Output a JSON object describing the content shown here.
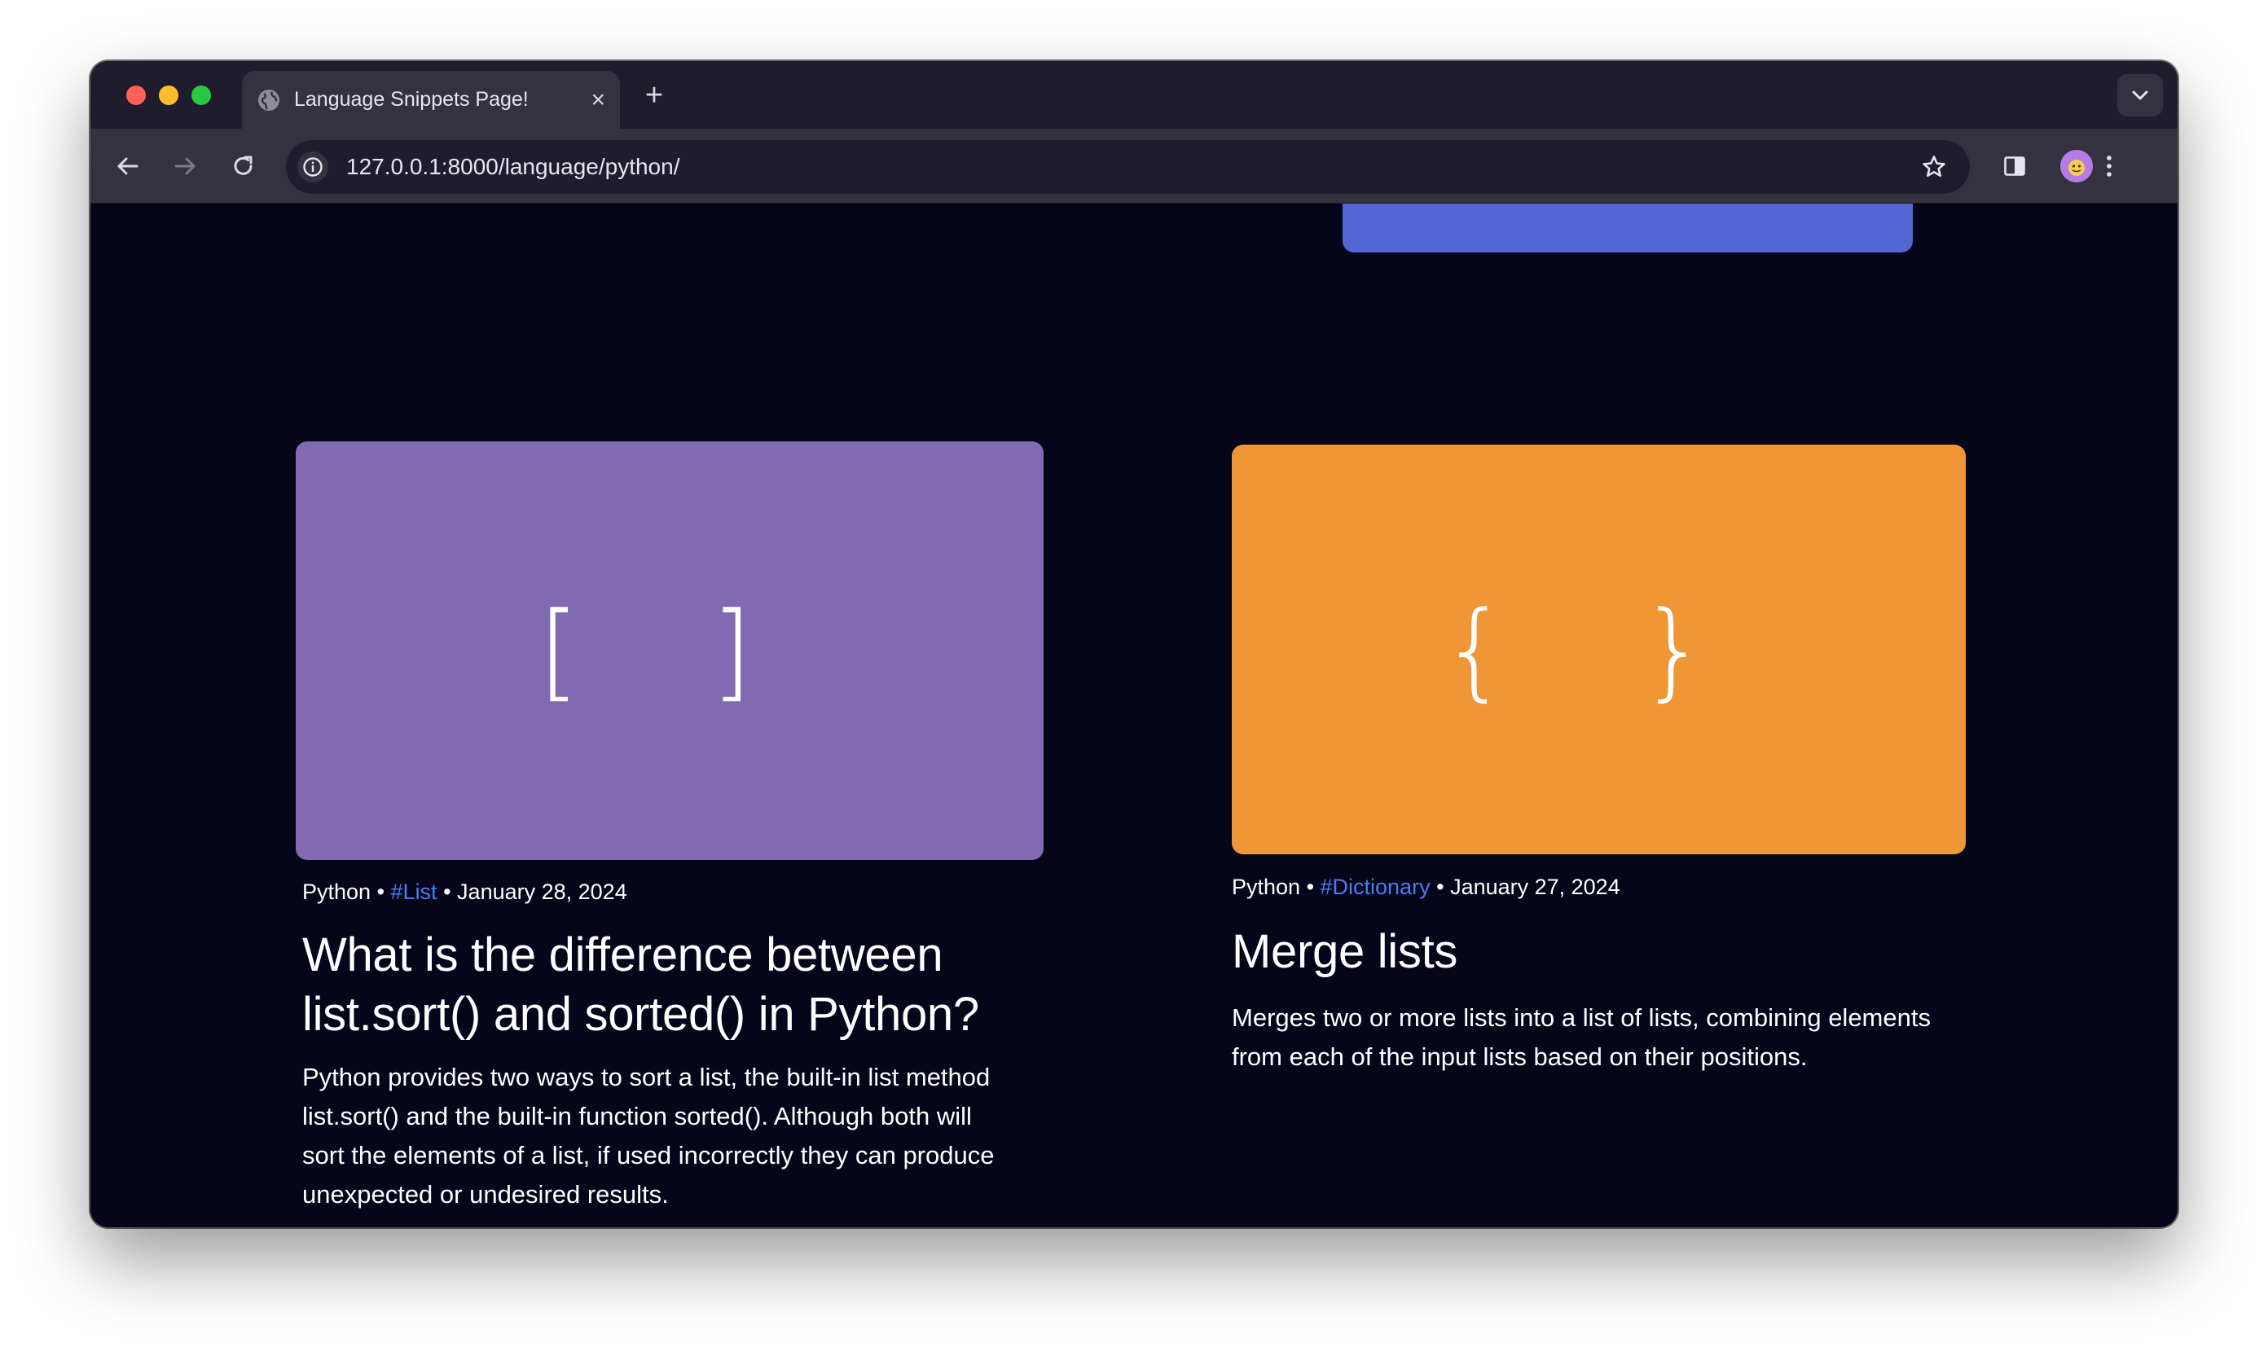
{
  "browser": {
    "tab": {
      "title": "Language Snippets Page!",
      "close_glyph": "×"
    },
    "new_tab_glyph": "+",
    "address_bar": {
      "url": "127.0.0.1:8000/language/python/"
    }
  },
  "cards": [
    {
      "thumbnail_glyph": "[ ]",
      "thumbnail_color": "#806bb3",
      "language": "Python",
      "separator": " • ",
      "tag": "#List",
      "date": "January 28, 2024",
      "title_line1": "What is the difference between",
      "title_line2": "list.sort() and sorted() in Python?",
      "desc_lines": [
        "Python provides two ways to sort a list, the built-in list method",
        "list.sort() and the built-in function sorted(). Although both will",
        "sort the elements of a list, if used incorrectly they can produce",
        "unexpected or undesired results."
      ]
    },
    {
      "thumbnail_glyph": "{ }",
      "thumbnail_color": "#ef9636",
      "language": "Python",
      "separator": " • ",
      "tag": "#Dictionary",
      "date": "January 27, 2024",
      "title_line1": "Merge lists",
      "desc_lines": [
        "Merges two or more lists into a list of lists, combining elements",
        "from each of the input lists based on their positions."
      ]
    }
  ],
  "colors": {
    "page_background": "#06061a",
    "tag_link": "#4a7cf0",
    "top_block": "#5266d4"
  }
}
